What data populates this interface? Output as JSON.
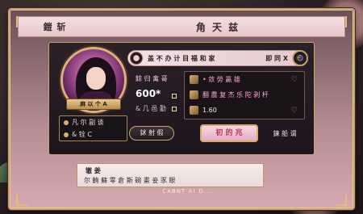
{
  "header": {
    "left_title": "鎧 斩",
    "center_title": "角 天 兹"
  },
  "profile": {
    "name_plate": "麻 以 个 A",
    "stats": [
      "凡 尔 副 谈",
      "& 铨 C"
    ]
  },
  "title_bar": {
    "text": "盖 不 办 计 目 福 和 家",
    "right_text": "即 同 X"
  },
  "price": {
    "label": "餘 归 禽 哥",
    "value": "600*",
    "sub": "& 几 邑 勤"
  },
  "items": [
    {
      "label": "• 敛 勞 贏 雄",
      "color": "pink"
    },
    {
      "label": "翻 農 复 杰 乐 陀 剥 杆",
      "color": "pink"
    },
    {
      "label": "1.60",
      "color": "white"
    }
  ],
  "buttons": {
    "small": "鉥 射 假",
    "main": "初 的 兆",
    "link": "鍊 船 谓"
  },
  "chat": {
    "speaker": "辙 姜",
    "message": "尔 齣 蘇 零 倉 斯 碗 畫 妾 豕 眼"
  },
  "footer": "CABNT A! D.....",
  "colors": {
    "gold": "#c8a46a",
    "pink_text": "#f7a7c9",
    "panel_bg": "#1e161c"
  }
}
